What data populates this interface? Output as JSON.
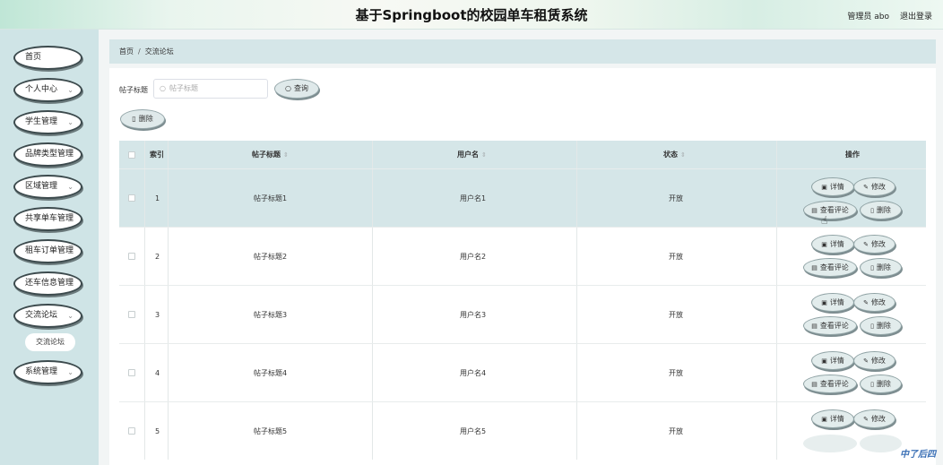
{
  "header": {
    "title": "基于Springboot的校园单车租赁系统",
    "user": "管理员 abo",
    "logout": "退出登录"
  },
  "sidebar": {
    "items": [
      {
        "label": "首页",
        "has_arrow": false
      },
      {
        "label": "个人中心",
        "has_arrow": true
      },
      {
        "label": "学生管理",
        "has_arrow": true
      },
      {
        "label": "品牌类型管理",
        "has_arrow": true
      },
      {
        "label": "区域管理",
        "has_arrow": true
      },
      {
        "label": "共享单车管理",
        "has_arrow": true
      },
      {
        "label": "租车订单管理",
        "has_arrow": true
      },
      {
        "label": "还车信息管理",
        "has_arrow": true
      },
      {
        "label": "交流论坛",
        "has_arrow": true
      },
      {
        "label": "系统管理",
        "has_arrow": true
      }
    ],
    "sub_item": "交流论坛"
  },
  "breadcrumb": {
    "home": "首页",
    "sep": "/",
    "current": "交流论坛"
  },
  "search": {
    "label": "帖子标题",
    "placeholder": "帖子标题",
    "button": "查询"
  },
  "toolbar": {
    "delete": "删除"
  },
  "table": {
    "headers": {
      "index": "索引",
      "title": "帖子标题",
      "username": "用户名",
      "status": "状态",
      "action": "操作"
    },
    "rows": [
      {
        "index": "1",
        "title": "帖子标题1",
        "username": "用户名1",
        "status": "开放"
      },
      {
        "index": "2",
        "title": "帖子标题2",
        "username": "用户名2",
        "status": "开放"
      },
      {
        "index": "3",
        "title": "帖子标题3",
        "username": "用户名3",
        "status": "开放"
      },
      {
        "index": "4",
        "title": "帖子标题4",
        "username": "用户名4",
        "status": "开放"
      },
      {
        "index": "5",
        "title": "帖子标题5",
        "username": "用户名5",
        "status": "开放"
      }
    ],
    "actions": {
      "detail": "详情",
      "edit": "修改",
      "comments": "查看评论",
      "delete": "删除"
    }
  },
  "watermark": "中了后四"
}
